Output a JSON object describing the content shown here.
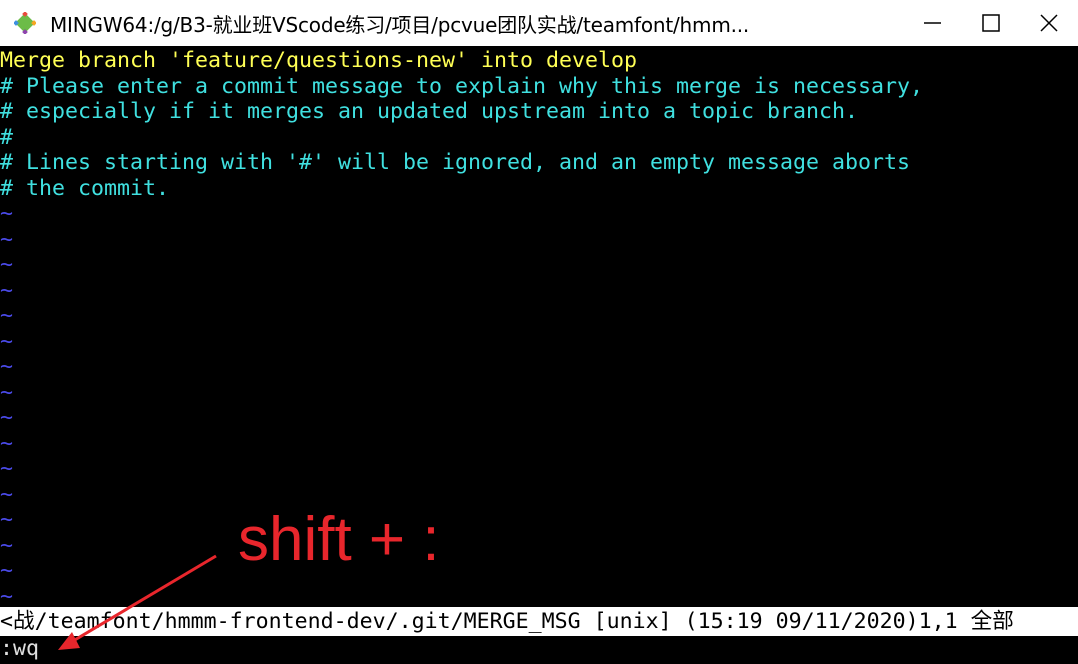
{
  "window": {
    "title": "MINGW64:/g/B3-就业班VScode练习/项目/pcvue团队实战/teamfont/hmm...",
    "app_icon": "git-icon",
    "controls": [
      "minimize-icon",
      "maximize-icon",
      "close-icon"
    ]
  },
  "editor": {
    "first_line": "Merge branch 'feature/questions-new' into develop",
    "comment_lines": [
      "# Please enter a commit message to explain why this merge is necessary,",
      "# especially if it merges an updated upstream into a topic branch.",
      "#",
      "# Lines starting with '#' will be ignored, and an empty message aborts",
      "# the commit."
    ],
    "empty_line_marker": "~",
    "status_line": "<战/teamfont/hmmm-frontend-dev/.git/MERGE_MSG [unix] (15:19 09/11/2020)1,1 全部",
    "command_line": ":wq"
  },
  "annotation": {
    "text": "shift + :",
    "color": "#e8262c"
  },
  "colors": {
    "background": "#000000",
    "merge_text": "#ffff55",
    "comment_text": "#40e0e0",
    "tilde_text": "#4a4ae8",
    "status_bg": "#ffffff"
  }
}
